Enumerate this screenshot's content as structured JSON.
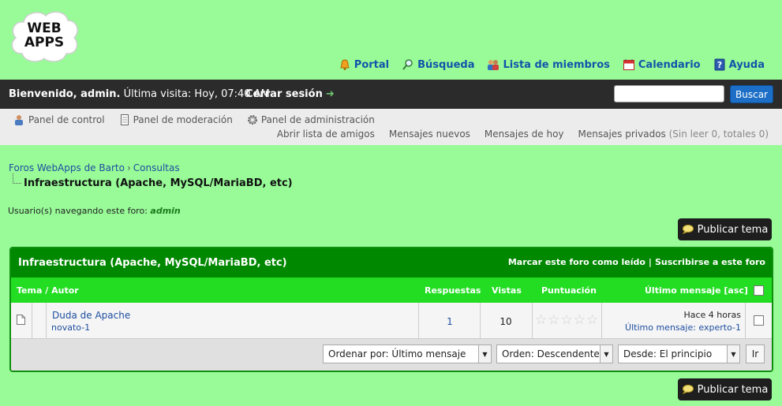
{
  "logo": {
    "line1": "WEB",
    "line2": "APPS"
  },
  "topnav": [
    {
      "label": "Portal",
      "icon": "bell-icon"
    },
    {
      "label": "Búsqueda",
      "icon": "magnifier-icon"
    },
    {
      "label": "Lista de miembros",
      "icon": "members-icon"
    },
    {
      "label": "Calendario",
      "icon": "calendar-icon"
    },
    {
      "label": "Ayuda",
      "icon": "help-icon"
    }
  ],
  "userbar": {
    "welcome_bold": "Bienvenido, admin.",
    "last_visit": "Última visita: Hoy, 07:40 AM",
    "logout": "Cerrar sesión",
    "search_placeholder": "",
    "search_button": "Buscar"
  },
  "admin_links": [
    {
      "label": "Panel de control",
      "icon": "user-cp-icon"
    },
    {
      "label": "Panel de moderación",
      "icon": "moderation-icon"
    },
    {
      "label": "Panel de administración",
      "icon": "gear-icon"
    }
  ],
  "quick_links": {
    "friends": "Abrir lista de amigos",
    "new_posts": "Mensajes nuevos",
    "today": "Mensajes de hoy",
    "pm_label": "Mensajes privados",
    "pm_status": "(Sin leer 0, totales 0)"
  },
  "breadcrumb": {
    "root": "Foros WebApps de Barto",
    "separator": "›",
    "section": "Consultas",
    "current": "Infraestructura (Apache, MySQL/MariaBD, etc)"
  },
  "browsing": {
    "label": "Usuario(s) navegando este foro:",
    "user": "admin"
  },
  "post_button": "Publicar tema",
  "forum": {
    "title": "Infraestructura (Apache, MySQL/MariaBD, etc)",
    "mark_read": "Marcar este foro como leído",
    "opt_sep": "|",
    "subscribe": "Suscribirse a este foro",
    "columns": {
      "topic": "Tema",
      "slash": "/",
      "author": "Autor",
      "replies": "Respuestas",
      "views": "Vistas",
      "rating": "Puntuación",
      "last": "Último mensaje",
      "order": "[asc]"
    },
    "threads": [
      {
        "title": "Duda de Apache",
        "author": "novato-1",
        "replies": "1",
        "views": "10",
        "rating": 0,
        "last_time": "Hace 4 horas",
        "last_label": "Último mensaje:",
        "last_user": "experto-1"
      }
    ],
    "sort": {
      "order_by": "Ordenar por: Último mensaje",
      "direction": "Orden: Descendente",
      "from": "Desde: El principio",
      "go": "Ir"
    }
  },
  "colors": {
    "page_bg": "#98fb98",
    "header_green": "#008800",
    "column_green": "#22dd22",
    "dark_bar": "#2b2b2b",
    "accent_blue": "#1c6ec6"
  }
}
